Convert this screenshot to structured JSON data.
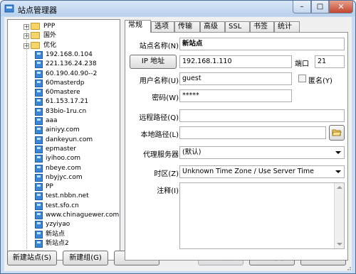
{
  "window": {
    "title": "站点管理器",
    "min_glyph": "–",
    "max_glyph": "□",
    "close_glyph": "✕"
  },
  "tree": {
    "items": [
      {
        "label": "PPP",
        "kind": "folder",
        "exp": "+"
      },
      {
        "label": "国外",
        "kind": "folder",
        "exp": "+"
      },
      {
        "label": "优化",
        "kind": "folder",
        "exp": "+"
      },
      {
        "label": "192.168.0.104",
        "kind": "site"
      },
      {
        "label": "221.136.24.238",
        "kind": "site"
      },
      {
        "label": "60.190.40.90--2",
        "kind": "site"
      },
      {
        "label": "60masterdp",
        "kind": "site"
      },
      {
        "label": "60mastere",
        "kind": "site"
      },
      {
        "label": "61.153.17.21",
        "kind": "site"
      },
      {
        "label": "83bio-1ru.cn",
        "kind": "site"
      },
      {
        "label": "aaa",
        "kind": "site"
      },
      {
        "label": "ainiyy.com",
        "kind": "site"
      },
      {
        "label": "dankeyun.com",
        "kind": "site"
      },
      {
        "label": "epmaster",
        "kind": "site"
      },
      {
        "label": "iyihoo.com",
        "kind": "site"
      },
      {
        "label": "nbeye.com",
        "kind": "site"
      },
      {
        "label": "nbyjyc.com",
        "kind": "site"
      },
      {
        "label": "PP",
        "kind": "site"
      },
      {
        "label": "test.nbbn.net",
        "kind": "site"
      },
      {
        "label": "test.sfo.cn",
        "kind": "site"
      },
      {
        "label": "www.chinaguewer.com",
        "kind": "site"
      },
      {
        "label": "yzyiyao",
        "kind": "site"
      },
      {
        "label": "新站点",
        "kind": "site"
      },
      {
        "label": "新站点2",
        "kind": "site"
      }
    ]
  },
  "buttons": {
    "new_site": "新建站点(S)",
    "new_group": "新建组(G)",
    "delete": "删除",
    "apply": "应用(A)",
    "connect": "连接(C)",
    "close": "关闭"
  },
  "tabs": [
    "常规",
    "选项",
    "传输",
    "高级",
    "SSL",
    "书签",
    "统计"
  ],
  "form": {
    "site_name_label": "站点名称(N)",
    "site_name": "新站点",
    "ip_button": "IP 地址",
    "ip": "192.168.1.110",
    "port_label": "端口",
    "port": "21",
    "user_label": "用户名称(U)",
    "user": "guest",
    "anon_label": "匿名(Y)",
    "password_label": "密码(W)",
    "password": "*****",
    "remote_label": "远程路径(Q)",
    "remote": "",
    "local_label": "本地路径(L)",
    "local": "",
    "proxy_label": "代理服务器",
    "proxy": "(默认)",
    "timezone_label": "时区(Z)",
    "timezone": "Unknown Time Zone / Use Server Time",
    "notes_label": "注释(I)",
    "notes": ""
  },
  "colors": {
    "titlebar": "#c9dcf1",
    "close": "#c3452c",
    "site_icon": "#3b86d6",
    "folder_icon": "#f4d56a"
  }
}
